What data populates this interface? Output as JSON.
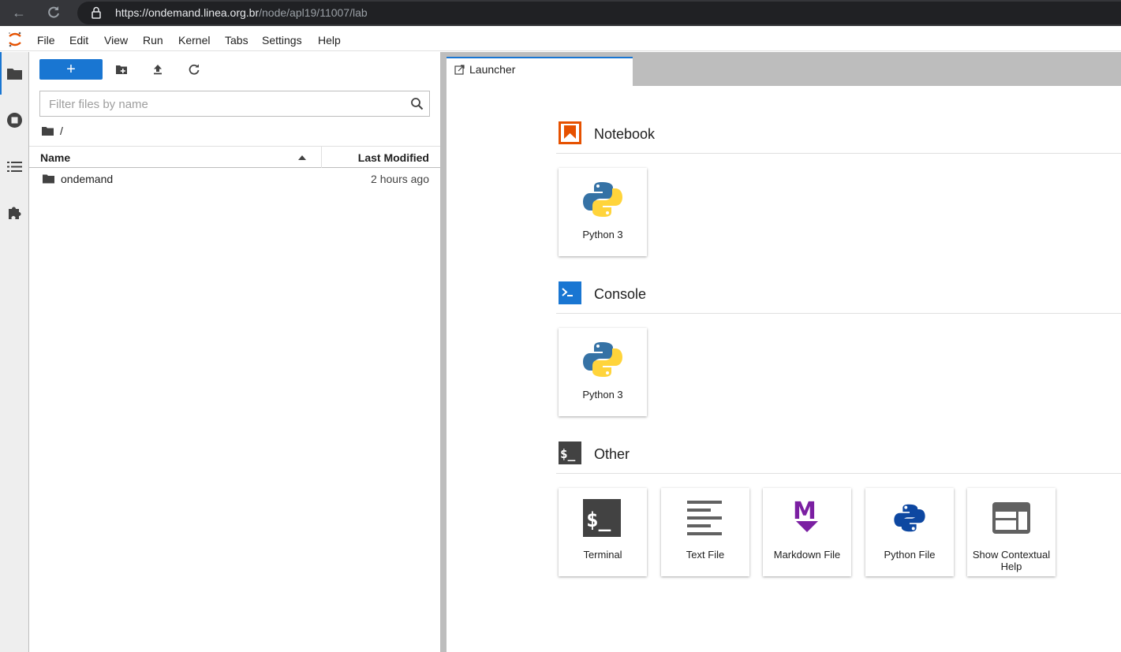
{
  "browser": {
    "url_host": "https://ondemand.linea.org.br",
    "url_path": "/node/apl19/11007/lab"
  },
  "menu": {
    "items": [
      "File",
      "Edit",
      "View",
      "Run",
      "Kernel",
      "Tabs",
      "Settings",
      "Help"
    ]
  },
  "filebrowser": {
    "new_label": "+",
    "filter_placeholder": "Filter files by name",
    "breadcrumb": "/",
    "columns": {
      "name": "Name",
      "modified": "Last Modified"
    },
    "rows": [
      {
        "name": "ondemand",
        "modified": "2 hours ago"
      }
    ]
  },
  "tab": {
    "label": "Launcher"
  },
  "launcher": {
    "notebook": {
      "title": "Notebook",
      "cards": [
        "Python 3"
      ]
    },
    "console": {
      "title": "Console",
      "cards": [
        "Python 3"
      ]
    },
    "other": {
      "title": "Other",
      "cards": [
        "Terminal",
        "Text File",
        "Markdown File",
        "Python File",
        "Show Contextual Help"
      ]
    }
  },
  "colors": {
    "accent": "#1976d2",
    "notebook_orange": "#e65100",
    "console_blue": "#1976d2",
    "markdown_purple": "#7b1fa2",
    "python_blue": "#3572a5",
    "python_yellow": "#ffd43b"
  }
}
